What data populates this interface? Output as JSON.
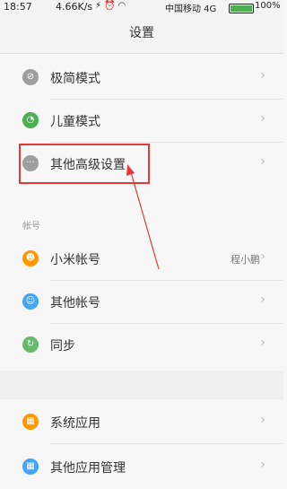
{
  "status": {
    "time": "18:57",
    "speed": "4.66K/s",
    "carrier": "中国移动 4G",
    "battery_percent": "100%"
  },
  "header": {
    "title": "设置"
  },
  "sections": {
    "general_items": [
      {
        "label": "极简模式",
        "icon": "minimal-mode-icon",
        "color": "#9e9e9e"
      },
      {
        "label": "儿童模式",
        "icon": "kids-mode-icon",
        "color": "#4caf50"
      },
      {
        "label": "其他高级设置",
        "icon": "more-settings-icon",
        "color": "#9e9e9e"
      }
    ],
    "account_title": "帐号",
    "account_items": [
      {
        "label": "小米帐号",
        "icon": "mi-account-icon",
        "color": "#ff9800",
        "value": "程小鹏"
      },
      {
        "label": "其他帐号",
        "icon": "other-accounts-icon",
        "color": "#42a5f5"
      },
      {
        "label": "同步",
        "icon": "sync-icon",
        "color": "#66bb6a"
      }
    ],
    "app_items": [
      {
        "label": "系统应用",
        "icon": "system-apps-icon",
        "color": "#ff9800"
      },
      {
        "label": "其他应用管理",
        "icon": "app-management-icon",
        "color": "#42a5f5"
      }
    ]
  },
  "annotation": {
    "color": "#e53935"
  }
}
